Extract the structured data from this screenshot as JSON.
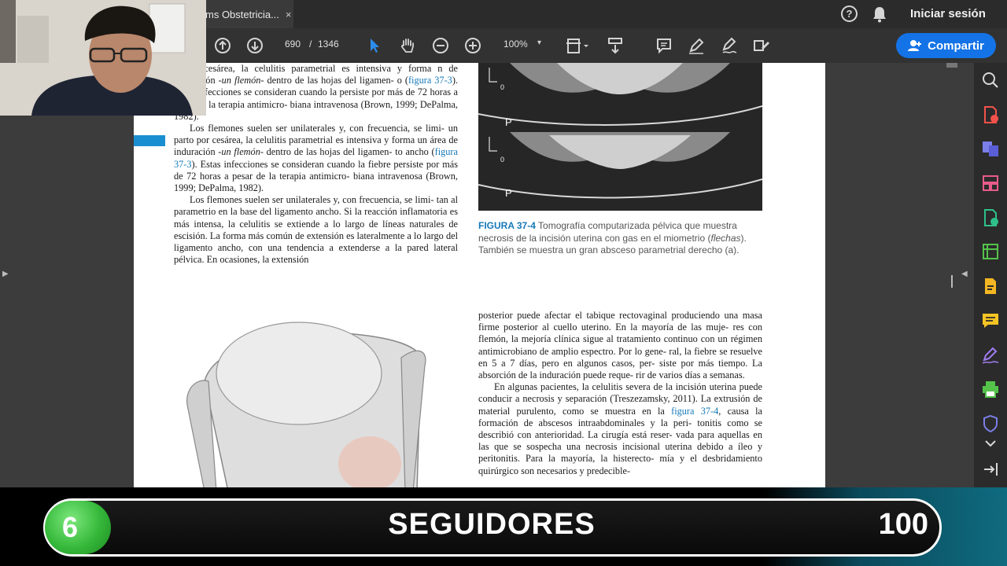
{
  "tab": {
    "title": "ms Obstetricia...",
    "close_glyph": "×"
  },
  "header": {
    "help_glyph": "?",
    "signin": "Iniciar sesión"
  },
  "toolbar": {
    "page_current": "690",
    "page_sep": "/",
    "page_total": "1346",
    "zoom": "100%",
    "share_label": "Compartir"
  },
  "document": {
    "left_paragraphs": [
      {
        "cont": true,
        "parts": [
          {
            "t": "o por cesárea, la celulitis parametrial es intensiva y forma n de induración -"
          },
          {
            "t": "un flemón",
            "i": true
          },
          {
            "t": "- dentro de las hojas del ligamen- o ("
          },
          {
            "t": "figura 37-3",
            "link": true
          },
          {
            "t": "). Estas infecciones se consideran cuando la persiste por más de 72 horas a pesar de la terapia antimicro- biana intravenosa (Brown, 1999; DePalma, 1982)."
          }
        ]
      },
      {
        "cont": false,
        "parts": [
          {
            "t": "Los flemones suelen ser unilaterales y, con frecuencia, se limi- un parto por cesárea, la celulitis parametrial es intensiva y forma un área de induración -"
          },
          {
            "t": "un flemón",
            "i": true
          },
          {
            "t": "- dentro de las hojas del ligamen- to ancho ("
          },
          {
            "t": "figura 37-3",
            "link": true
          },
          {
            "t": "). Estas infecciones se consideran cuando la fiebre persiste por más de 72 horas a pesar de la terapia antimicro- biana intravenosa (Brown, 1999; DePalma, 1982)."
          }
        ]
      },
      {
        "cont": false,
        "parts": [
          {
            "t": "Los flemones suelen ser unilaterales y, con frecuencia, se limi- tan al parametrio en la base del ligamento ancho. Si la reacción inflamatoria es más intensa, la celulitis se extiende a lo largo de líneas naturales de escisión. La forma más común de extensión es lateralmente a lo largo del ligamento ancho, con una tendencia a extenderse a la pared lateral pélvica. En ocasiones, la extensión"
          }
        ]
      }
    ],
    "figure": {
      "label": "FIGURA 37-4",
      "caption_a": " Tomografía computarizada pélvica que muestra necrosis de la incisión uterina con gas en el miometrio (",
      "caption_i": "flechas",
      "caption_b": "). También se muestra un gran absceso parametrial derecho (a).",
      "ct_marks": [
        "0",
        "P",
        "0",
        "P"
      ]
    },
    "right_paragraphs": [
      {
        "cont": true,
        "parts": [
          {
            "t": "posterior puede afectar el tabique rectovaginal produciendo una masa firme posterior al cuello uterino. En la mayoría de las muje- res con flemón, la mejoría clínica sigue al tratamiento continuo con un régimen antimicrobiano de amplio espectro. Por lo gene- ral, la fiebre se resuelve en 5 a 7 días, pero en algunos casos, per- siste por más tiempo. La absorción de la induración puede reque- rir de varios días a semanas."
          }
        ]
      },
      {
        "cont": false,
        "parts": [
          {
            "t": "En algunas pacientes, la celulitis severa de la incisión uterina puede conducir a necrosis y separación (Treszezamsky, 2011). La extrusión de material purulento, como se muestra en la "
          },
          {
            "t": "figura 37-4",
            "link": true
          },
          {
            "t": ", causa la formación de abscesos intraabdominales y la peri- tonitis como se describió con anterioridad. La cirugía está reser- vada para aquellas en las que se sospecha una necrosis incisional uterina debido a íleo y peritonitis. Para la mayoría, la histerecto- mía y el desbridamiento quirúrgico son necesarios y predecible-"
          }
        ]
      }
    ]
  },
  "stream_overlay": {
    "badge_number": "6",
    "label": "SEGUIDORES",
    "count": "100"
  },
  "colors": {
    "accent_blue": "#1473e6",
    "link_blue": "#1679b8",
    "badge_green": "#35b83a"
  },
  "right_rail_icons": [
    "zoom-search-icon",
    "export-pdf-icon",
    "combine-files-icon",
    "organize-pages-icon",
    "create-pdf-icon",
    "edit-pdf-icon",
    "export-file-icon",
    "comment-icon",
    "fill-sign-icon",
    "print-production-icon",
    "protect-icon",
    "expand-icon",
    "collapse-panel-icon"
  ]
}
